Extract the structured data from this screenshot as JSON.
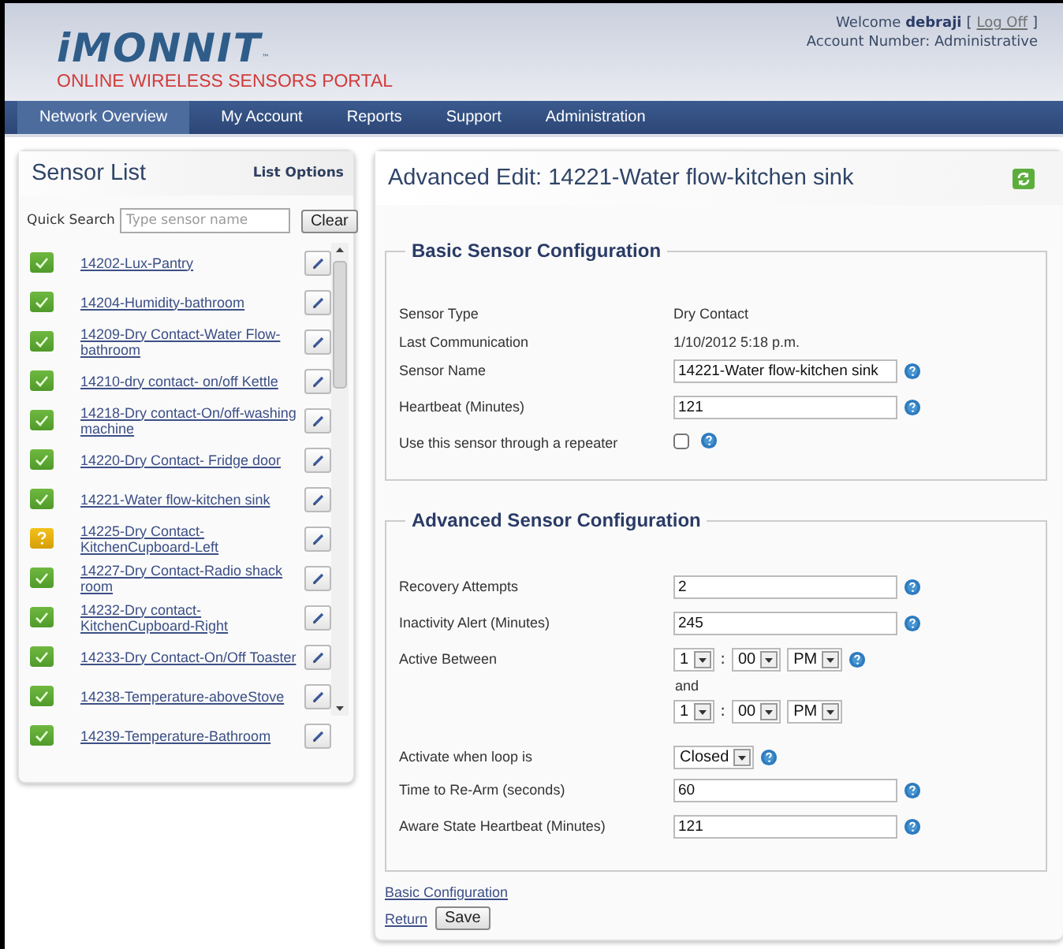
{
  "header": {
    "logo": "iMONNIT",
    "logo_mark": "™",
    "tagline": "ONLINE WIRELESS SENSORS PORTAL",
    "welcome": "Welcome ",
    "user": "debraji",
    "bracket_open": "[",
    "logoff": "Log Off",
    "bracket_close": "]",
    "account": "Account Number: Administrative"
  },
  "nav": [
    {
      "label": "Network Overview",
      "selected": true
    },
    {
      "label": "My Account",
      "selected": false
    },
    {
      "label": "Reports",
      "selected": false
    },
    {
      "label": "Support",
      "selected": false
    },
    {
      "label": "Administration",
      "selected": false
    }
  ],
  "sensor_list": {
    "title": "Sensor List",
    "options": "List Options",
    "search_label": "Quick Search",
    "search_placeholder": "Type sensor name",
    "clear": "Clear",
    "items": [
      {
        "name": "14202-Lux-Pantry",
        "kind": "ok"
      },
      {
        "name": "14204-Humidity-bathroom",
        "kind": "ok"
      },
      {
        "name": "14209-Dry Contact-Water Flow-bathroom",
        "kind": "ok"
      },
      {
        "name": "14210-dry contact- on/off Kettle",
        "kind": "ok"
      },
      {
        "name": "14218-Dry contact-On/off-washing machine",
        "kind": "ok"
      },
      {
        "name": "14220-Dry Contact- Fridge door",
        "kind": "ok"
      },
      {
        "name": "14221-Water flow-kitchen sink",
        "kind": "ok"
      },
      {
        "name": "14225-Dry Contact-KitchenCupboard-Left",
        "kind": "unknown"
      },
      {
        "name": "14227-Dry Contact-Radio shack room",
        "kind": "ok"
      },
      {
        "name": "14232-Dry contact-KitchenCupboard-Right",
        "kind": "ok"
      },
      {
        "name": "14233-Dry Contact-On/Off Toaster",
        "kind": "ok"
      },
      {
        "name": "14238-Temperature-aboveStove",
        "kind": "ok"
      },
      {
        "name": "14239-Temperature-Bathroom",
        "kind": "ok"
      }
    ]
  },
  "editor": {
    "title": "Advanced Edit: 14221-Water flow-kitchen sink",
    "sections": [
      {
        "title": "Basic Sensor Configuration",
        "rows": [
          {
            "kind": "static",
            "label": "Sensor Type",
            "value": "Dry Contact"
          },
          {
            "kind": "static",
            "label": "Last Communication",
            "value": "1/10/2012 5:18 p.m."
          },
          {
            "kind": "input",
            "label": "Sensor Name",
            "value": "14221-Water flow-kitchen sink"
          },
          {
            "kind": "input",
            "label": "Heartbeat (Minutes)",
            "value": "121"
          },
          {
            "kind": "checkbox",
            "label": "Use this sensor through a repeater",
            "checked": false
          }
        ]
      },
      {
        "title": "Advanced Sensor Configuration",
        "rows": [
          {
            "kind": "input",
            "label": "Recovery Attempts",
            "value": "2"
          },
          {
            "kind": "input",
            "label": "Inactivity Alert (Minutes)",
            "value": "245"
          },
          {
            "kind": "time",
            "label": "Active Between",
            "hour": "1",
            "sep": ":",
            "minute": "00",
            "ampm": "PM",
            "joiner": "and",
            "hour2": "1",
            "sep2": ":",
            "minute2": "00",
            "ampm2": "PM"
          },
          {
            "kind": "select",
            "label": "Activate when loop is",
            "value": "Closed"
          },
          {
            "kind": "input",
            "label": "Time to Re-Arm (seconds)",
            "value": "60"
          },
          {
            "kind": "input",
            "label": "Aware State Heartbeat (Minutes)",
            "value": "121"
          }
        ]
      }
    ],
    "basic_link": "Basic Configuration",
    "return_link": "Return",
    "save": "Save"
  }
}
